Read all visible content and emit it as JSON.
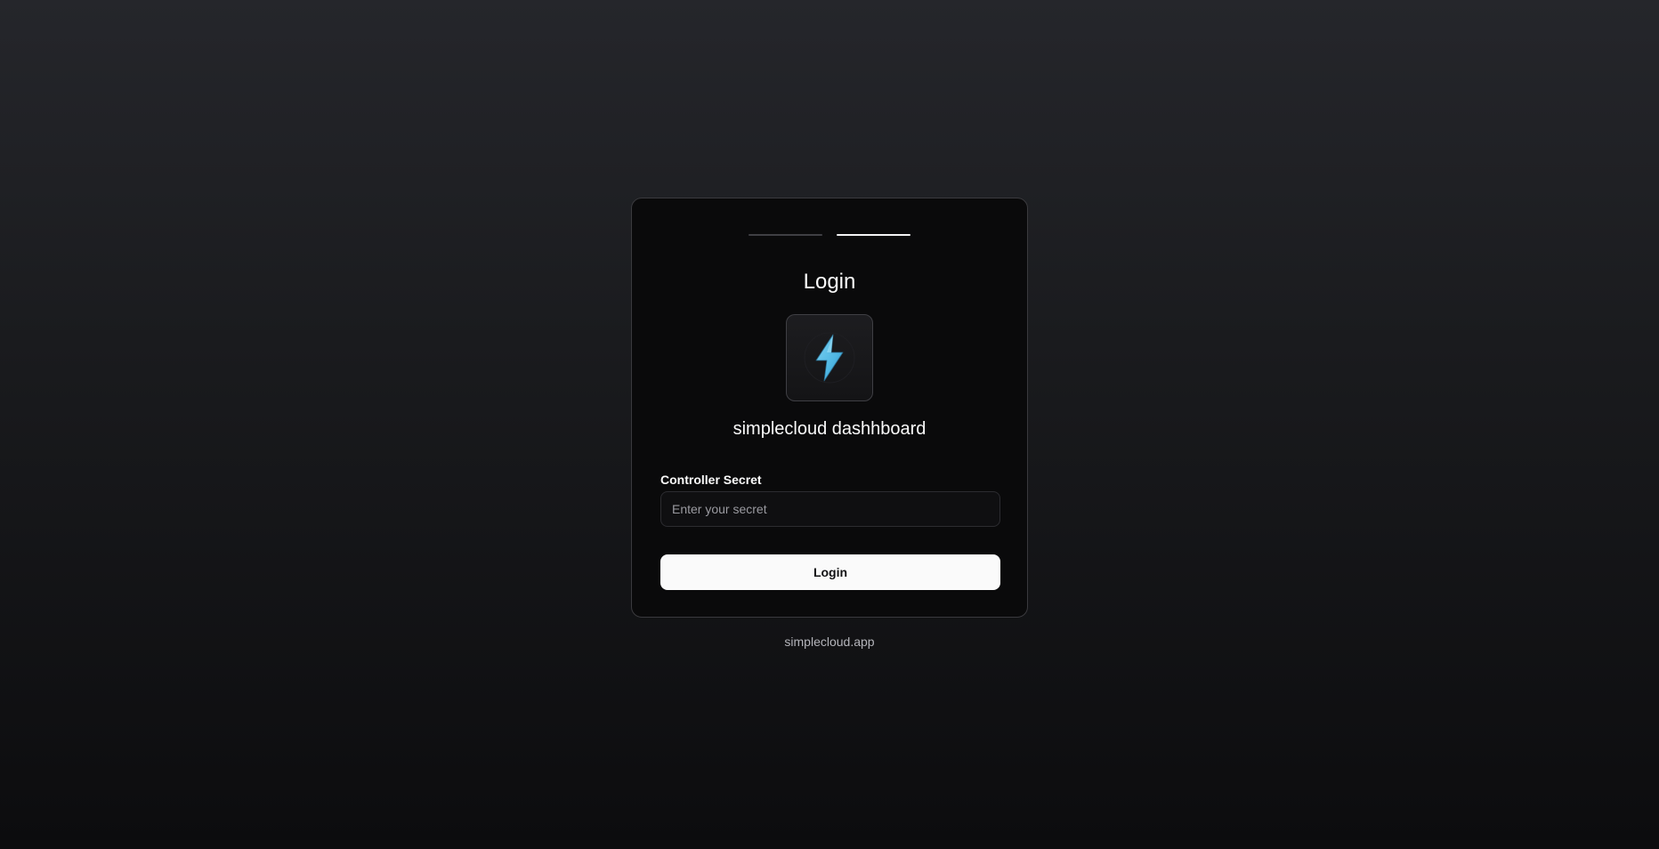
{
  "progress": {
    "steps": [
      {
        "state": "inactive"
      },
      {
        "state": "active"
      }
    ]
  },
  "login": {
    "title": "Login",
    "logo_icon": "lightning-bolt-icon",
    "app_name": "simplecloud dashhboard",
    "secret_label": "Controller Secret",
    "secret_placeholder": "Enter your secret",
    "secret_value": "",
    "button_label": "Login"
  },
  "footer": {
    "link_text": "simplecloud.app"
  },
  "colors": {
    "accent_bolt": "#5bbfe6",
    "button_bg": "#fafafa",
    "card_bg": "#0a0a0b"
  }
}
